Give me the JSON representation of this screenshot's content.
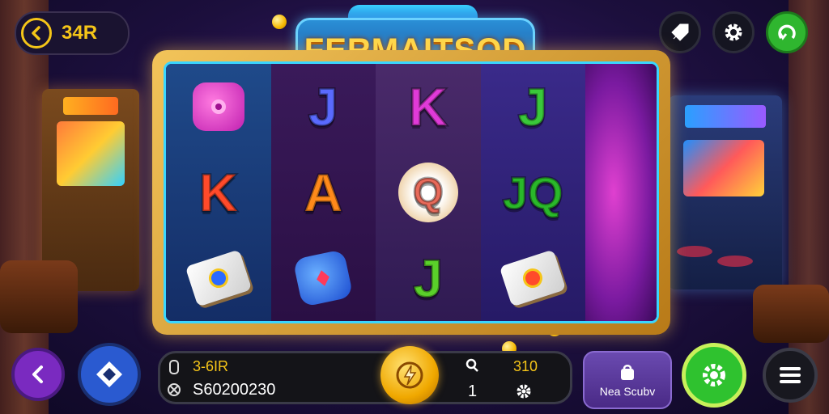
{
  "header": {
    "back_label": "34R",
    "game_title": "FERMAITSOD"
  },
  "top_actions": {
    "left_icon": "rocket-icon",
    "middle_icon": "gear-icon",
    "right_icon": "refresh-icon"
  },
  "reels": [
    [
      "gem-pink",
      "K",
      "dice"
    ],
    [
      "J",
      "A",
      "gem-blue"
    ],
    [
      "K",
      "Q",
      "J"
    ],
    [
      "J",
      "JQ",
      "dice"
    ]
  ],
  "info_bar": {
    "balance_label": "3-6IR",
    "balance_value": "S60200230",
    "lines_label": "310",
    "lines_value": "1"
  },
  "promo": {
    "label": "Nea Scubv"
  },
  "colors": {
    "accent_gold": "#f5c518",
    "frame_cyan": "#3ad6ff",
    "spin_green": "#2fc22f",
    "back_purple": "#7a2ac0"
  }
}
